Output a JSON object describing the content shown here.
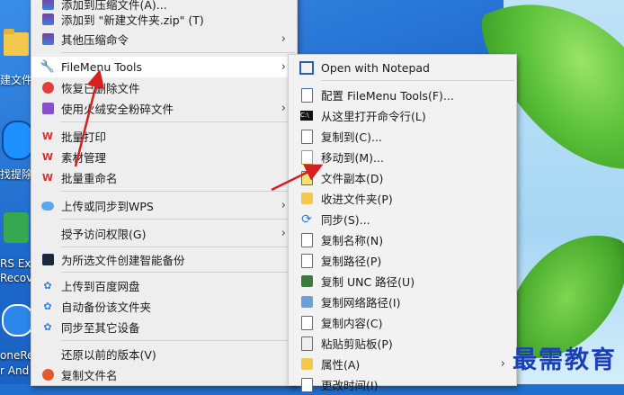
{
  "desktop": {
    "icons": [
      {
        "label": "建文件",
        "icon": "folder-icon"
      },
      {
        "label": "找提除",
        "icon": "app-icon"
      },
      {
        "label": "RS Exc",
        "icon": "app-icon"
      },
      {
        "label": "Recove",
        "icon": "app-icon"
      },
      {
        "label": "oneRe",
        "icon": "app-icon"
      },
      {
        "label": "r And",
        "icon": "app-icon"
      }
    ]
  },
  "context_menu": {
    "items": [
      {
        "label": "添加到压缩文件(A)...",
        "icon": "archive-icon"
      },
      {
        "label": "添加到 \"新建文件夹.zip\" (T)",
        "icon": "archive-icon"
      },
      {
        "label": "其他压缩命令",
        "icon": "archive-icon",
        "submenu": true
      },
      {
        "label": "FileMenu Tools",
        "icon": "filemenu-tools-icon",
        "submenu": true
      },
      {
        "label": "恢复已删除文件",
        "icon": "recover-icon"
      },
      {
        "label": "使用火绒安全粉碎文件",
        "icon": "shred-icon",
        "submenu": true
      },
      {
        "label": "批量打印",
        "icon": "wps-icon"
      },
      {
        "label": "素材管理",
        "icon": "wps-icon"
      },
      {
        "label": "批量重命名",
        "icon": "wps-icon"
      },
      {
        "label": "上传或同步到WPS",
        "icon": "cloud-upload-icon",
        "submenu": true
      },
      {
        "label": "授予访问权限(G)",
        "icon": "",
        "submenu": true
      },
      {
        "label": "为所选文件创建智能备份",
        "icon": "backup-icon"
      },
      {
        "label": "上传到百度网盘",
        "icon": "baidu-icon"
      },
      {
        "label": "自动备份该文件夹",
        "icon": "baidu-icon"
      },
      {
        "label": "同步至其它设备",
        "icon": "baidu-icon"
      },
      {
        "label": "还原以前的版本(V)",
        "icon": ""
      },
      {
        "label": "复制文件名",
        "icon": "copy-name-icon"
      }
    ]
  },
  "submenu": {
    "items": [
      {
        "label": "Open with Notepad",
        "icon": "notepad-icon"
      },
      {
        "label": "配置 FileMenu Tools(F)...",
        "icon": "settings-icon"
      },
      {
        "label": "从这里打开命令行(L)",
        "icon": "cmd-icon"
      },
      {
        "label": "复制到(C)...",
        "icon": "copy-to-icon"
      },
      {
        "label": "移动到(M)...",
        "icon": "move-to-icon"
      },
      {
        "label": "文件副本(D)",
        "icon": "duplicate-icon"
      },
      {
        "label": "收进文件夹(P)",
        "icon": "pack-folder-icon"
      },
      {
        "label": "同步(S)...",
        "icon": "sync-icon"
      },
      {
        "label": "复制名称(N)",
        "icon": "copy-name-icon"
      },
      {
        "label": "复制路径(P)",
        "icon": "copy-path-icon"
      },
      {
        "label": "复制 UNC 路径(U)",
        "icon": "unc-icon"
      },
      {
        "label": "复制网络路径(I)",
        "icon": "network-icon"
      },
      {
        "label": "复制内容(C)",
        "icon": "copy-content-icon"
      },
      {
        "label": "粘贴剪贴板(P)",
        "icon": "clipboard-icon"
      },
      {
        "label": "属性(A)",
        "icon": "properties-icon",
        "submenu": true
      },
      {
        "label": "更改时间(I)",
        "icon": "time-icon"
      }
    ]
  },
  "watermark": "最需教育",
  "colors": {
    "accent": "#1b3fb5",
    "arrow": "#d62020",
    "wps": "#e02b2b"
  }
}
